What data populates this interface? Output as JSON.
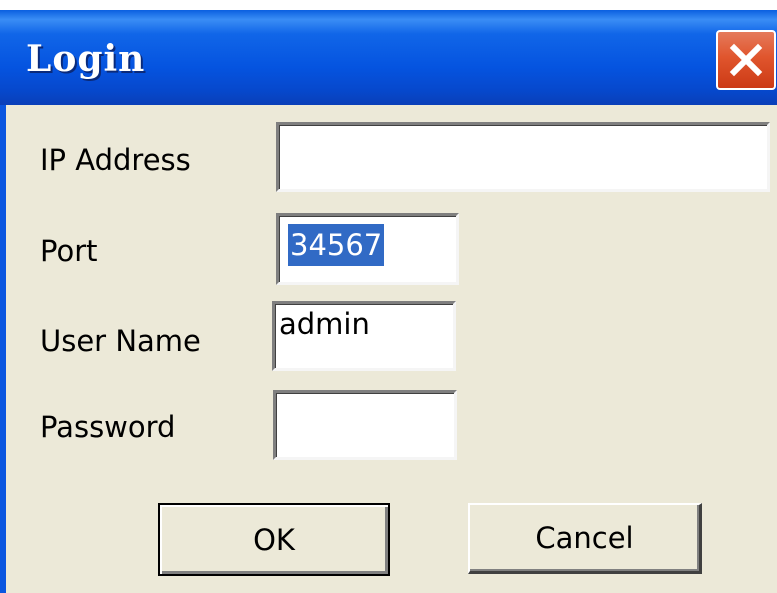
{
  "window": {
    "title": "Login",
    "close_icon": "close-x-icon"
  },
  "form": {
    "ip_label": "IP Address",
    "ip_value": "",
    "port_label": "Port",
    "port_value": "34567",
    "username_label": "User Name",
    "username_value": "admin",
    "password_label": "Password",
    "password_value": ""
  },
  "buttons": {
    "ok_label": "OK",
    "cancel_label": "Cancel"
  },
  "colors": {
    "titlebar": "#0554e0",
    "close_button": "#e0552d",
    "dialog_background": "#ece9d8",
    "selection": "#316ac5"
  }
}
